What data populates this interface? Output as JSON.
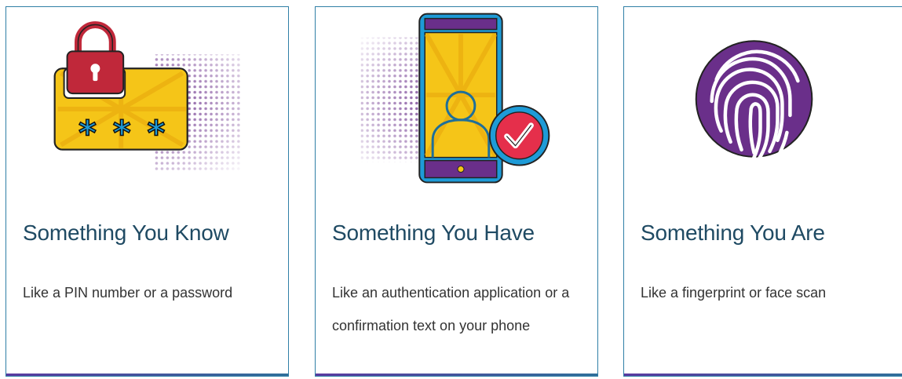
{
  "cards": [
    {
      "title": "Something You Know",
      "description": "Like a PIN number or a password",
      "icon": "padlock-password-icon"
    },
    {
      "title": "Something You Have",
      "description": "Like an authentication application or a confirmation text on your phone",
      "icon": "smartphone-verified-user-icon"
    },
    {
      "title": "Something You Are",
      "description": "Like a fingerprint or face scan",
      "icon": "fingerprint-icon"
    }
  ],
  "colors": {
    "card_border": "#2f7fa6",
    "title": "#1f4a63",
    "text": "#333333",
    "purple": "#6a2f8a",
    "yellow": "#f5c518",
    "red": "#c0283a",
    "blue": "#1e9bd7"
  }
}
